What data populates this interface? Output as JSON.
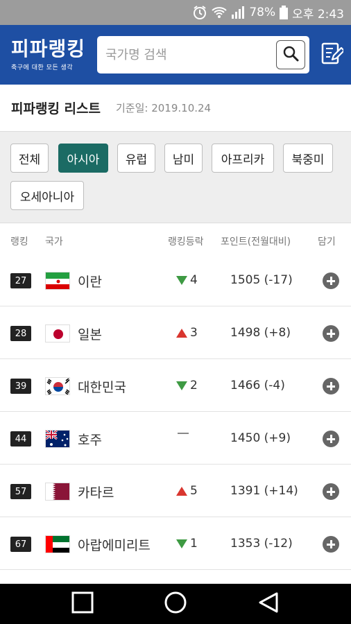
{
  "status_bar": {
    "battery": "78%",
    "time": "오후 2:43",
    "icons": [
      "alarm-icon",
      "wifi-icon",
      "signal-icon",
      "battery-icon"
    ]
  },
  "header": {
    "logo_title": "피파랭킹",
    "logo_subtitle": "축구에 대한 모든 생각",
    "search_placeholder": "국가명 검색",
    "search_icon": "search-icon",
    "edit_icon": "edit-icon",
    "brand_color": "#1e4fa3"
  },
  "list": {
    "title": "피파랭킹 리스트",
    "date": "기준일: 2019.10.24"
  },
  "filters": {
    "active_color": "#1b6b64",
    "items": [
      {
        "label": "전체",
        "active": false
      },
      {
        "label": "아시아",
        "active": true
      },
      {
        "label": "유럽",
        "active": false
      },
      {
        "label": "남미",
        "active": false
      },
      {
        "label": "아프리카",
        "active": false
      },
      {
        "label": "북중미",
        "active": false
      },
      {
        "label": "오세아니아",
        "active": false
      }
    ]
  },
  "table": {
    "headers": {
      "rank": "랭킹",
      "country": "국가",
      "change": "랭킹등락",
      "points": "포인트(전월대비)",
      "add": "담기"
    },
    "rows": [
      {
        "rank": "27",
        "flag": "iran-flag",
        "country": "이란",
        "direction": "down",
        "change": "4",
        "points": "1505 (-17)"
      },
      {
        "rank": "28",
        "flag": "japan-flag",
        "country": "일본",
        "direction": "up",
        "change": "3",
        "points": "1498 (+8)"
      },
      {
        "rank": "39",
        "flag": "korea-flag",
        "country": "대한민국",
        "direction": "down",
        "change": "2",
        "points": "1466 (-4)"
      },
      {
        "rank": "44",
        "flag": "australia-flag",
        "country": "호주",
        "direction": "none",
        "change": "",
        "points": "1450 (+9)"
      },
      {
        "rank": "57",
        "flag": "qatar-flag",
        "country": "카타르",
        "direction": "up",
        "change": "5",
        "points": "1391 (+14)"
      },
      {
        "rank": "67",
        "flag": "uae-flag",
        "country": "아랍에미리트",
        "direction": "down",
        "change": "1",
        "points": "1353 (-12)"
      }
    ],
    "up_color": "#d9362f",
    "down_color": "#3e9a43"
  },
  "nav_bar": {
    "icons": [
      "recent-apps-icon",
      "home-icon",
      "back-icon"
    ]
  }
}
